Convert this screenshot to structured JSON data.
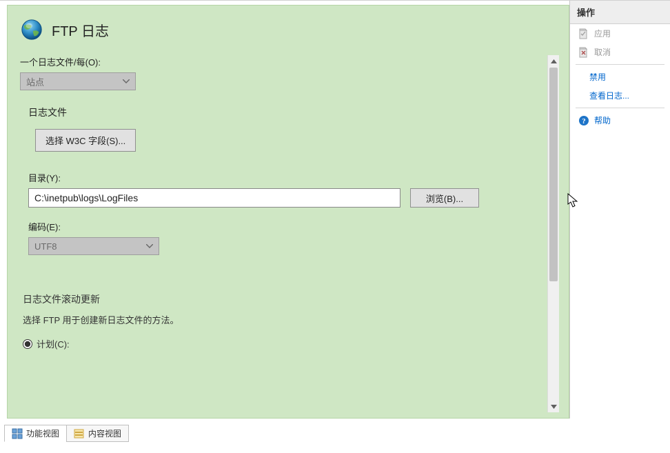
{
  "header": {
    "title": "FTP 日志"
  },
  "form": {
    "oneLogFilePer": {
      "label": "一个日志文件/每(O):",
      "value": "站点"
    },
    "logFileSection": {
      "title": "日志文件",
      "selectFieldsButton": "选择 W3C 字段(S)...",
      "directoryLabel": "目录(Y):",
      "directoryValue": "C:\\inetpub\\logs\\LogFiles",
      "browseButton": "浏览(B)...",
      "encodingLabel": "编码(E):",
      "encodingValue": "UTF8"
    },
    "rollover": {
      "title": "日志文件滚动更新",
      "description": "选择 FTP 用于创建新日志文件的方法。",
      "scheduleOption": "计划(C):"
    }
  },
  "actions": {
    "header": "操作",
    "apply": "应用",
    "cancel": "取消",
    "disable": "禁用",
    "viewLogs": "查看日志...",
    "help": "帮助"
  },
  "bottomTabs": {
    "features": "功能视图",
    "content": "内容视图"
  }
}
